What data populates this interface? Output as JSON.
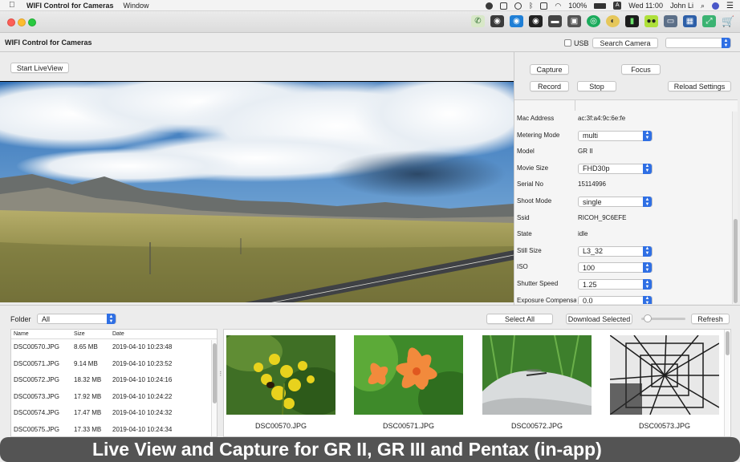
{
  "menubar": {
    "app_name": "WIFI Control for Cameras",
    "menus": [
      "Window"
    ],
    "battery": "100%",
    "clock": "Wed 11:00",
    "user": "John Li",
    "input_badge": "A"
  },
  "header": {
    "title": "WIFI Control for Cameras",
    "usb_label": "USB",
    "usb_checked": false,
    "search_camera_label": "Search Camera",
    "camera_select_value": ""
  },
  "liveview": {
    "start_label": "Start LiveView"
  },
  "controls": {
    "capture": "Capture",
    "focus": "Focus",
    "record": "Record",
    "stop": "Stop",
    "reload": "Reload Settings"
  },
  "properties": [
    {
      "name": "Mac Address",
      "value": "ac:3f:a4:9c:6e:fe",
      "editable": false
    },
    {
      "name": "Metering Mode",
      "value": "multi",
      "editable": true
    },
    {
      "name": "Model",
      "value": "GR II",
      "editable": false
    },
    {
      "name": "Movie Size",
      "value": "FHD30p",
      "editable": true
    },
    {
      "name": "Serial No",
      "value": "15114996",
      "editable": false
    },
    {
      "name": "Shoot Mode",
      "value": "single",
      "editable": true
    },
    {
      "name": "Ssid",
      "value": "RICOH_9C6EFE",
      "editable": false
    },
    {
      "name": "State",
      "value": "idle",
      "editable": false
    },
    {
      "name": "Still Size",
      "value": "L3_32",
      "editable": true
    },
    {
      "name": "ISO",
      "value": "100",
      "editable": true
    },
    {
      "name": "Shutter Speed",
      "value": "1.25",
      "editable": true
    },
    {
      "name": "Exposure Compensation",
      "value": "0.0",
      "editable": true
    }
  ],
  "browser": {
    "folder_label": "Folder",
    "folder_value": "All",
    "select_all": "Select All",
    "download_selected": "Download Selected",
    "refresh": "Refresh",
    "thumb_size_fraction": 0.15,
    "columns": {
      "name": "Name",
      "size": "Size",
      "date": "Date"
    },
    "files": [
      {
        "name": "DSC00570.JPG",
        "size": "8.65 MB",
        "date": "2019-04-10 10:23:48"
      },
      {
        "name": "DSC00571.JPG",
        "size": "9.14 MB",
        "date": "2019-04-10 10:23:52"
      },
      {
        "name": "DSC00572.JPG",
        "size": "18.32 MB",
        "date": "2019-04-10 10:24:16"
      },
      {
        "name": "DSC00573.JPG",
        "size": "17.92 MB",
        "date": "2019-04-10 10:24:22"
      },
      {
        "name": "DSC00574.JPG",
        "size": "17.47 MB",
        "date": "2019-04-10 10:24:32"
      },
      {
        "name": "DSC00575.JPG",
        "size": "17.33 MB",
        "date": "2019-04-10 10:24:34"
      }
    ],
    "thumbnails": [
      "DSC00570.JPG",
      "DSC00571.JPG",
      "DSC00572.JPG",
      "DSC00573.JPG"
    ]
  },
  "caption": "Live View and Capture for GR II, GR III and Pentax (in-app)",
  "colors": {
    "accent": "#2f6fe4",
    "caption_bg": "#464646"
  }
}
